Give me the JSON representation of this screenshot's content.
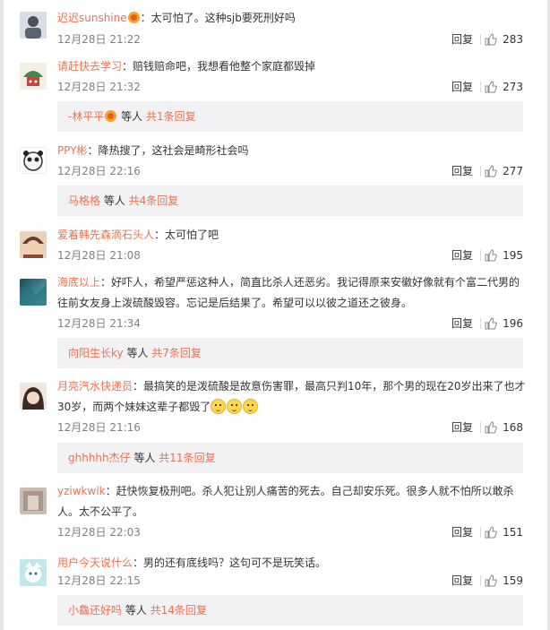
{
  "comments": [
    {
      "user": "迟迟sunshine",
      "text": "：太可怕了。这种sjb要死刑好吗",
      "time": "12月28日 21:22",
      "reply": "回复",
      "likes": "283"
    },
    {
      "user": "请赶快去学习",
      "text": "：赔钱赔命吧，我想看他整个家庭都毁掉",
      "time": "12月28日 21:32",
      "reply": "回复",
      "likes": "273",
      "sub_user": "-林平平",
      "sub_suffix": " 等人 ",
      "sub_count": "共1条回复"
    },
    {
      "user": "PPY彬",
      "text": "：降热搜了，这社会是畸形社会吗",
      "time": "12月28日 22:16",
      "reply": "回复",
      "likes": "277",
      "sub_user": "马格格",
      "sub_suffix": " 等人 ",
      "sub_count": "共4条回复"
    },
    {
      "user": "爱着韩先森滴石头人",
      "text": "：太可怕了吧",
      "time": "12月28日 21:08",
      "reply": "回复",
      "likes": "195"
    },
    {
      "user": "海底以上",
      "text_line1": "：好吓人，希望严惩这种人，简直比杀人还恶劣。我记得原来安徽好像就有个富二代男的",
      "text_line2": "往前女友身上泼硫酸毁容。忘记是后结果了。希望可以以彼之道还之彼身。",
      "time": "12月28日 21:34",
      "reply": "回复",
      "likes": "196",
      "sub_user": "向阳生长ky",
      "sub_suffix": " 等人 ",
      "sub_count": "共7条回复"
    },
    {
      "user": "月亮汽水快递员",
      "text_line1": "：最搞笑的是泼硫酸是故意伤害罪，最高只判10年，那个男的现在20岁出来了也才",
      "text_line2": "30岁，而两个妹妹这辈子都毁了",
      "time": "12月28日 21:16",
      "reply": "回复",
      "likes": "168",
      "sub_user": "ghhhhh杰仔",
      "sub_suffix": " 等人 ",
      "sub_count": "共11条回复"
    },
    {
      "user": "yziwkwlk",
      "text_line1": "：赶快恢复极刑吧。杀人犯让别人痛苦的死去。自己却安乐死。很多人就不怕所以敢杀",
      "text_line2": "人。太不公平了。",
      "time": "12月28日 22:03",
      "reply": "回复",
      "likes": "151"
    },
    {
      "user": "用户今天说什么",
      "text": "：男的还有底线吗？这句可不是玩笑话。",
      "time": "12月28日 22:15",
      "reply": "回复",
      "likes": "159",
      "sub_user": "小鱻还好吗",
      "sub_suffix": " 等人 ",
      "sub_count": "共14条回复"
    }
  ],
  "colors": {
    "username": "#eb7350",
    "meta": "#808080",
    "subreply_bg": "#f2f2f5"
  },
  "icons": {
    "like": "thumbs-up-icon",
    "verified": "medal-badge-icon",
    "emoji": "worried-face-emoji"
  }
}
